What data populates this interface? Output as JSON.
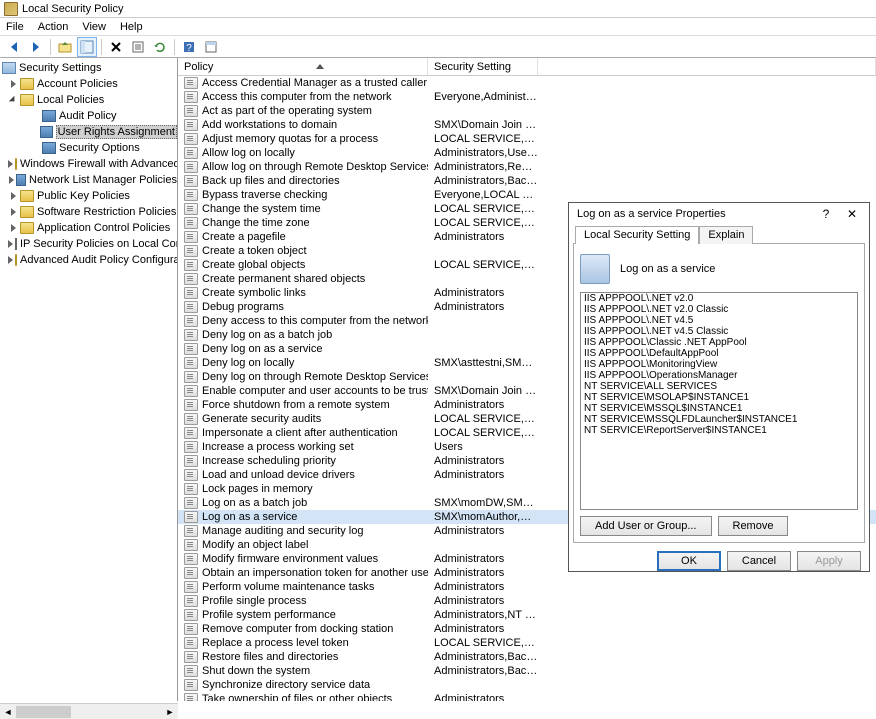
{
  "window": {
    "title": "Local Security Policy"
  },
  "menu": {
    "file": "File",
    "action": "Action",
    "view": "View",
    "help": "Help"
  },
  "tree": {
    "root": "Security Settings",
    "items": [
      {
        "label": "Account Policies"
      },
      {
        "label": "Local Policies",
        "expanded": true,
        "children": [
          {
            "label": "Audit Policy"
          },
          {
            "label": "User Rights Assignment",
            "selected": true
          },
          {
            "label": "Security Options"
          }
        ]
      },
      {
        "label": "Windows Firewall with Advanced Sec"
      },
      {
        "label": "Network List Manager Policies"
      },
      {
        "label": "Public Key Policies"
      },
      {
        "label": "Software Restriction Policies"
      },
      {
        "label": "Application Control Policies"
      },
      {
        "label": "IP Security Policies on Local Compute"
      },
      {
        "label": "Advanced Audit Policy Configuration"
      }
    ]
  },
  "columns": {
    "policy": "Policy",
    "setting": "Security Setting"
  },
  "policies": [
    {
      "p": "Access Credential Manager as a trusted caller",
      "s": ""
    },
    {
      "p": "Access this computer from the network",
      "s": "Everyone,Administrators..."
    },
    {
      "p": "Act as part of the operating system",
      "s": ""
    },
    {
      "p": "Add workstations to domain",
      "s": "SMX\\Domain Join Users"
    },
    {
      "p": "Adjust memory quotas for a process",
      "s": "LOCAL SERVICE,NETWO..."
    },
    {
      "p": "Allow log on locally",
      "s": "Administrators,Users,Ba..."
    },
    {
      "p": "Allow log on through Remote Desktop Services",
      "s": "Administrators,Remote ..."
    },
    {
      "p": "Back up files and directories",
      "s": "Administrators,Backup ..."
    },
    {
      "p": "Bypass traverse checking",
      "s": "Everyone,LOCAL SERVIC..."
    },
    {
      "p": "Change the system time",
      "s": "LOCAL SERVICE,Admini..."
    },
    {
      "p": "Change the time zone",
      "s": "LOCAL SERVICE,Admini..."
    },
    {
      "p": "Create a pagefile",
      "s": "Administrators"
    },
    {
      "p": "Create a token object",
      "s": ""
    },
    {
      "p": "Create global objects",
      "s": "LOCAL SERVICE,NETWO..."
    },
    {
      "p": "Create permanent shared objects",
      "s": ""
    },
    {
      "p": "Create symbolic links",
      "s": "Administrators"
    },
    {
      "p": "Debug programs",
      "s": "Administrators"
    },
    {
      "p": "Deny access to this computer from the network",
      "s": ""
    },
    {
      "p": "Deny log on as a batch job",
      "s": ""
    },
    {
      "p": "Deny log on as a service",
      "s": ""
    },
    {
      "p": "Deny log on locally",
      "s": "SMX\\asttestni,SMX\\mo..."
    },
    {
      "p": "Deny log on through Remote Desktop Services",
      "s": ""
    },
    {
      "p": "Enable computer and user accounts to be trusted for delega...",
      "s": "SMX\\Domain Join Users,..."
    },
    {
      "p": "Force shutdown from a remote system",
      "s": "Administrators"
    },
    {
      "p": "Generate security audits",
      "s": "LOCAL SERVICE,NETWO..."
    },
    {
      "p": "Impersonate a client after authentication",
      "s": "LOCAL SERVICE,NETWO..."
    },
    {
      "p": "Increase a process working set",
      "s": "Users"
    },
    {
      "p": "Increase scheduling priority",
      "s": "Administrators"
    },
    {
      "p": "Load and unload device drivers",
      "s": "Administrators"
    },
    {
      "p": "Lock pages in memory",
      "s": ""
    },
    {
      "p": "Log on as a batch job",
      "s": "SMX\\momDW,SMX\\mo..."
    },
    {
      "p": "Log on as a service",
      "s": "SMX\\momAuthor,SMX\\...",
      "selected": true
    },
    {
      "p": "Manage auditing and security log",
      "s": "Administrators"
    },
    {
      "p": "Modify an object label",
      "s": ""
    },
    {
      "p": "Modify firmware environment values",
      "s": "Administrators"
    },
    {
      "p": "Obtain an impersonation token for another user in the same...",
      "s": "Administrators"
    },
    {
      "p": "Perform volume maintenance tasks",
      "s": "Administrators"
    },
    {
      "p": "Profile single process",
      "s": "Administrators"
    },
    {
      "p": "Profile system performance",
      "s": "Administrators,NT SERVI..."
    },
    {
      "p": "Remove computer from docking station",
      "s": "Administrators"
    },
    {
      "p": "Replace a process level token",
      "s": "LOCAL SERVICE,NETWO..."
    },
    {
      "p": "Restore files and directories",
      "s": "Administrators,Backup ..."
    },
    {
      "p": "Shut down the system",
      "s": "Administrators,Backup ..."
    },
    {
      "p": "Synchronize directory service data",
      "s": ""
    },
    {
      "p": "Take ownership of files or other objects",
      "s": "Administrators"
    }
  ],
  "dialog": {
    "title": "Log on as a service Properties",
    "tab_local": "Local Security Setting",
    "tab_explain": "Explain",
    "heading": "Log on as a service",
    "principals": [
      "IIS APPPOOL\\.NET v2.0",
      "IIS APPPOOL\\.NET v2.0 Classic",
      "IIS APPPOOL\\.NET v4.5",
      "IIS APPPOOL\\.NET v4.5 Classic",
      "IIS APPPOOL\\Classic .NET AppPool",
      "IIS APPPOOL\\DefaultAppPool",
      "IIS APPPOOL\\MonitoringView",
      "IIS APPPOOL\\OperationsManager",
      "NT SERVICE\\ALL SERVICES",
      "NT SERVICE\\MSOLAP$INSTANCE1",
      "NT SERVICE\\MSSQL$INSTANCE1",
      "NT SERVICE\\MSSQLFDLauncher$INSTANCE1",
      "NT SERVICE\\ReportServer$INSTANCE1"
    ],
    "btn_add": "Add User or Group...",
    "btn_remove": "Remove",
    "btn_ok": "OK",
    "btn_cancel": "Cancel",
    "btn_apply": "Apply"
  }
}
